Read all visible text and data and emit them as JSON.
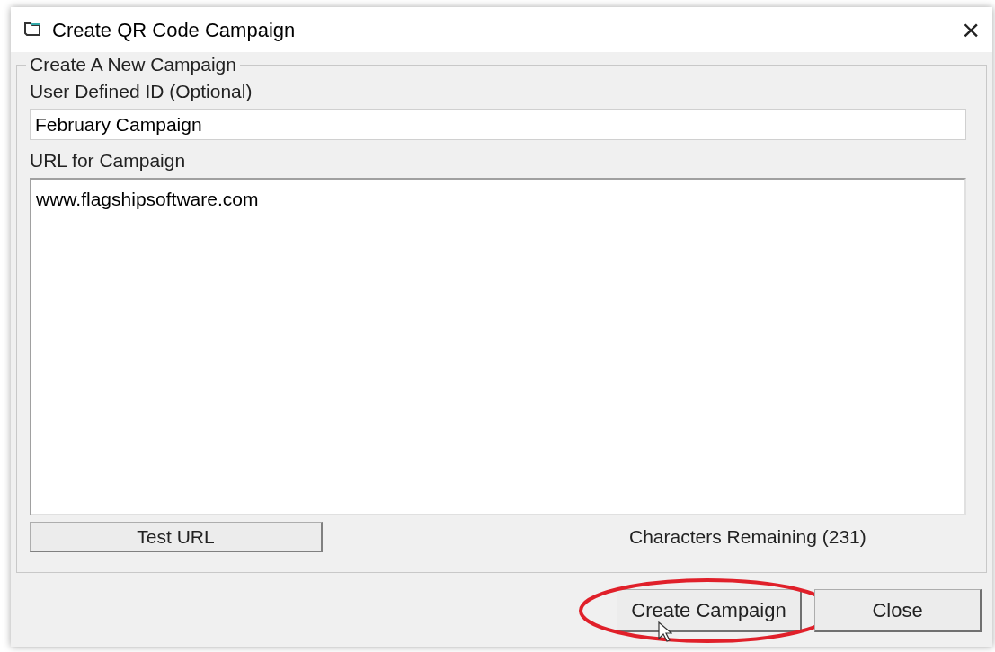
{
  "window": {
    "title": "Create QR Code Campaign",
    "close": "×"
  },
  "group": {
    "title": "Create A New Campaign"
  },
  "id_field": {
    "label": "User Defined ID (Optional)",
    "value": "February Campaign"
  },
  "url_field": {
    "label": "URL for Campaign",
    "value": "www.flagshipsoftware.com"
  },
  "test_button": "Test URL",
  "remaining": "Characters Remaining (231)",
  "buttons": [
    {
      "label": "Create Campaign",
      "highlighted": true
    },
    {
      "label": "Close",
      "highlighted": false
    }
  ]
}
